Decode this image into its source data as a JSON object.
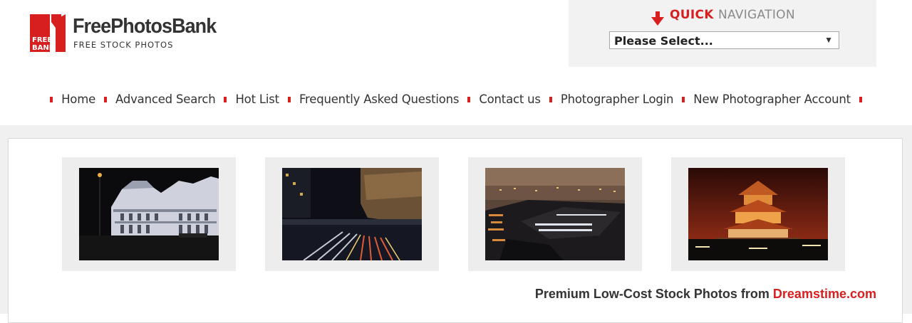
{
  "header": {
    "logo": {
      "brand_main": "FreePhotos",
      "brand_accent": "Bank",
      "tagline": "FREE STOCK PHOTOS",
      "mark_text_top": "FREE",
      "mark_text_bottom": "BANK"
    },
    "quick_nav": {
      "title_accent": "QUICK",
      "title_rest": "NAVIGATION",
      "select_value": "Please Select..."
    }
  },
  "nav": {
    "items": [
      {
        "label": "Home"
      },
      {
        "label": "Advanced Search"
      },
      {
        "label": "Hot List"
      },
      {
        "label": "Frequently Asked Questions"
      },
      {
        "label": "Contact us"
      },
      {
        "label": "Photographer Login"
      },
      {
        "label": "New Photographer Account"
      }
    ]
  },
  "gallery": {
    "thumbnails": [
      {
        "icon": "photo-opera-house-night"
      },
      {
        "icon": "photo-city-traffic-night"
      },
      {
        "icon": "photo-city-skyline-night"
      },
      {
        "icon": "photo-bell-tower-night"
      }
    ]
  },
  "promo": {
    "text": "Premium Low-Cost Stock Photos from ",
    "brand": "Dreamstime.com"
  },
  "colors": {
    "accent": "#d81f1f",
    "text": "#333333",
    "panel": "#f2f2f2"
  }
}
